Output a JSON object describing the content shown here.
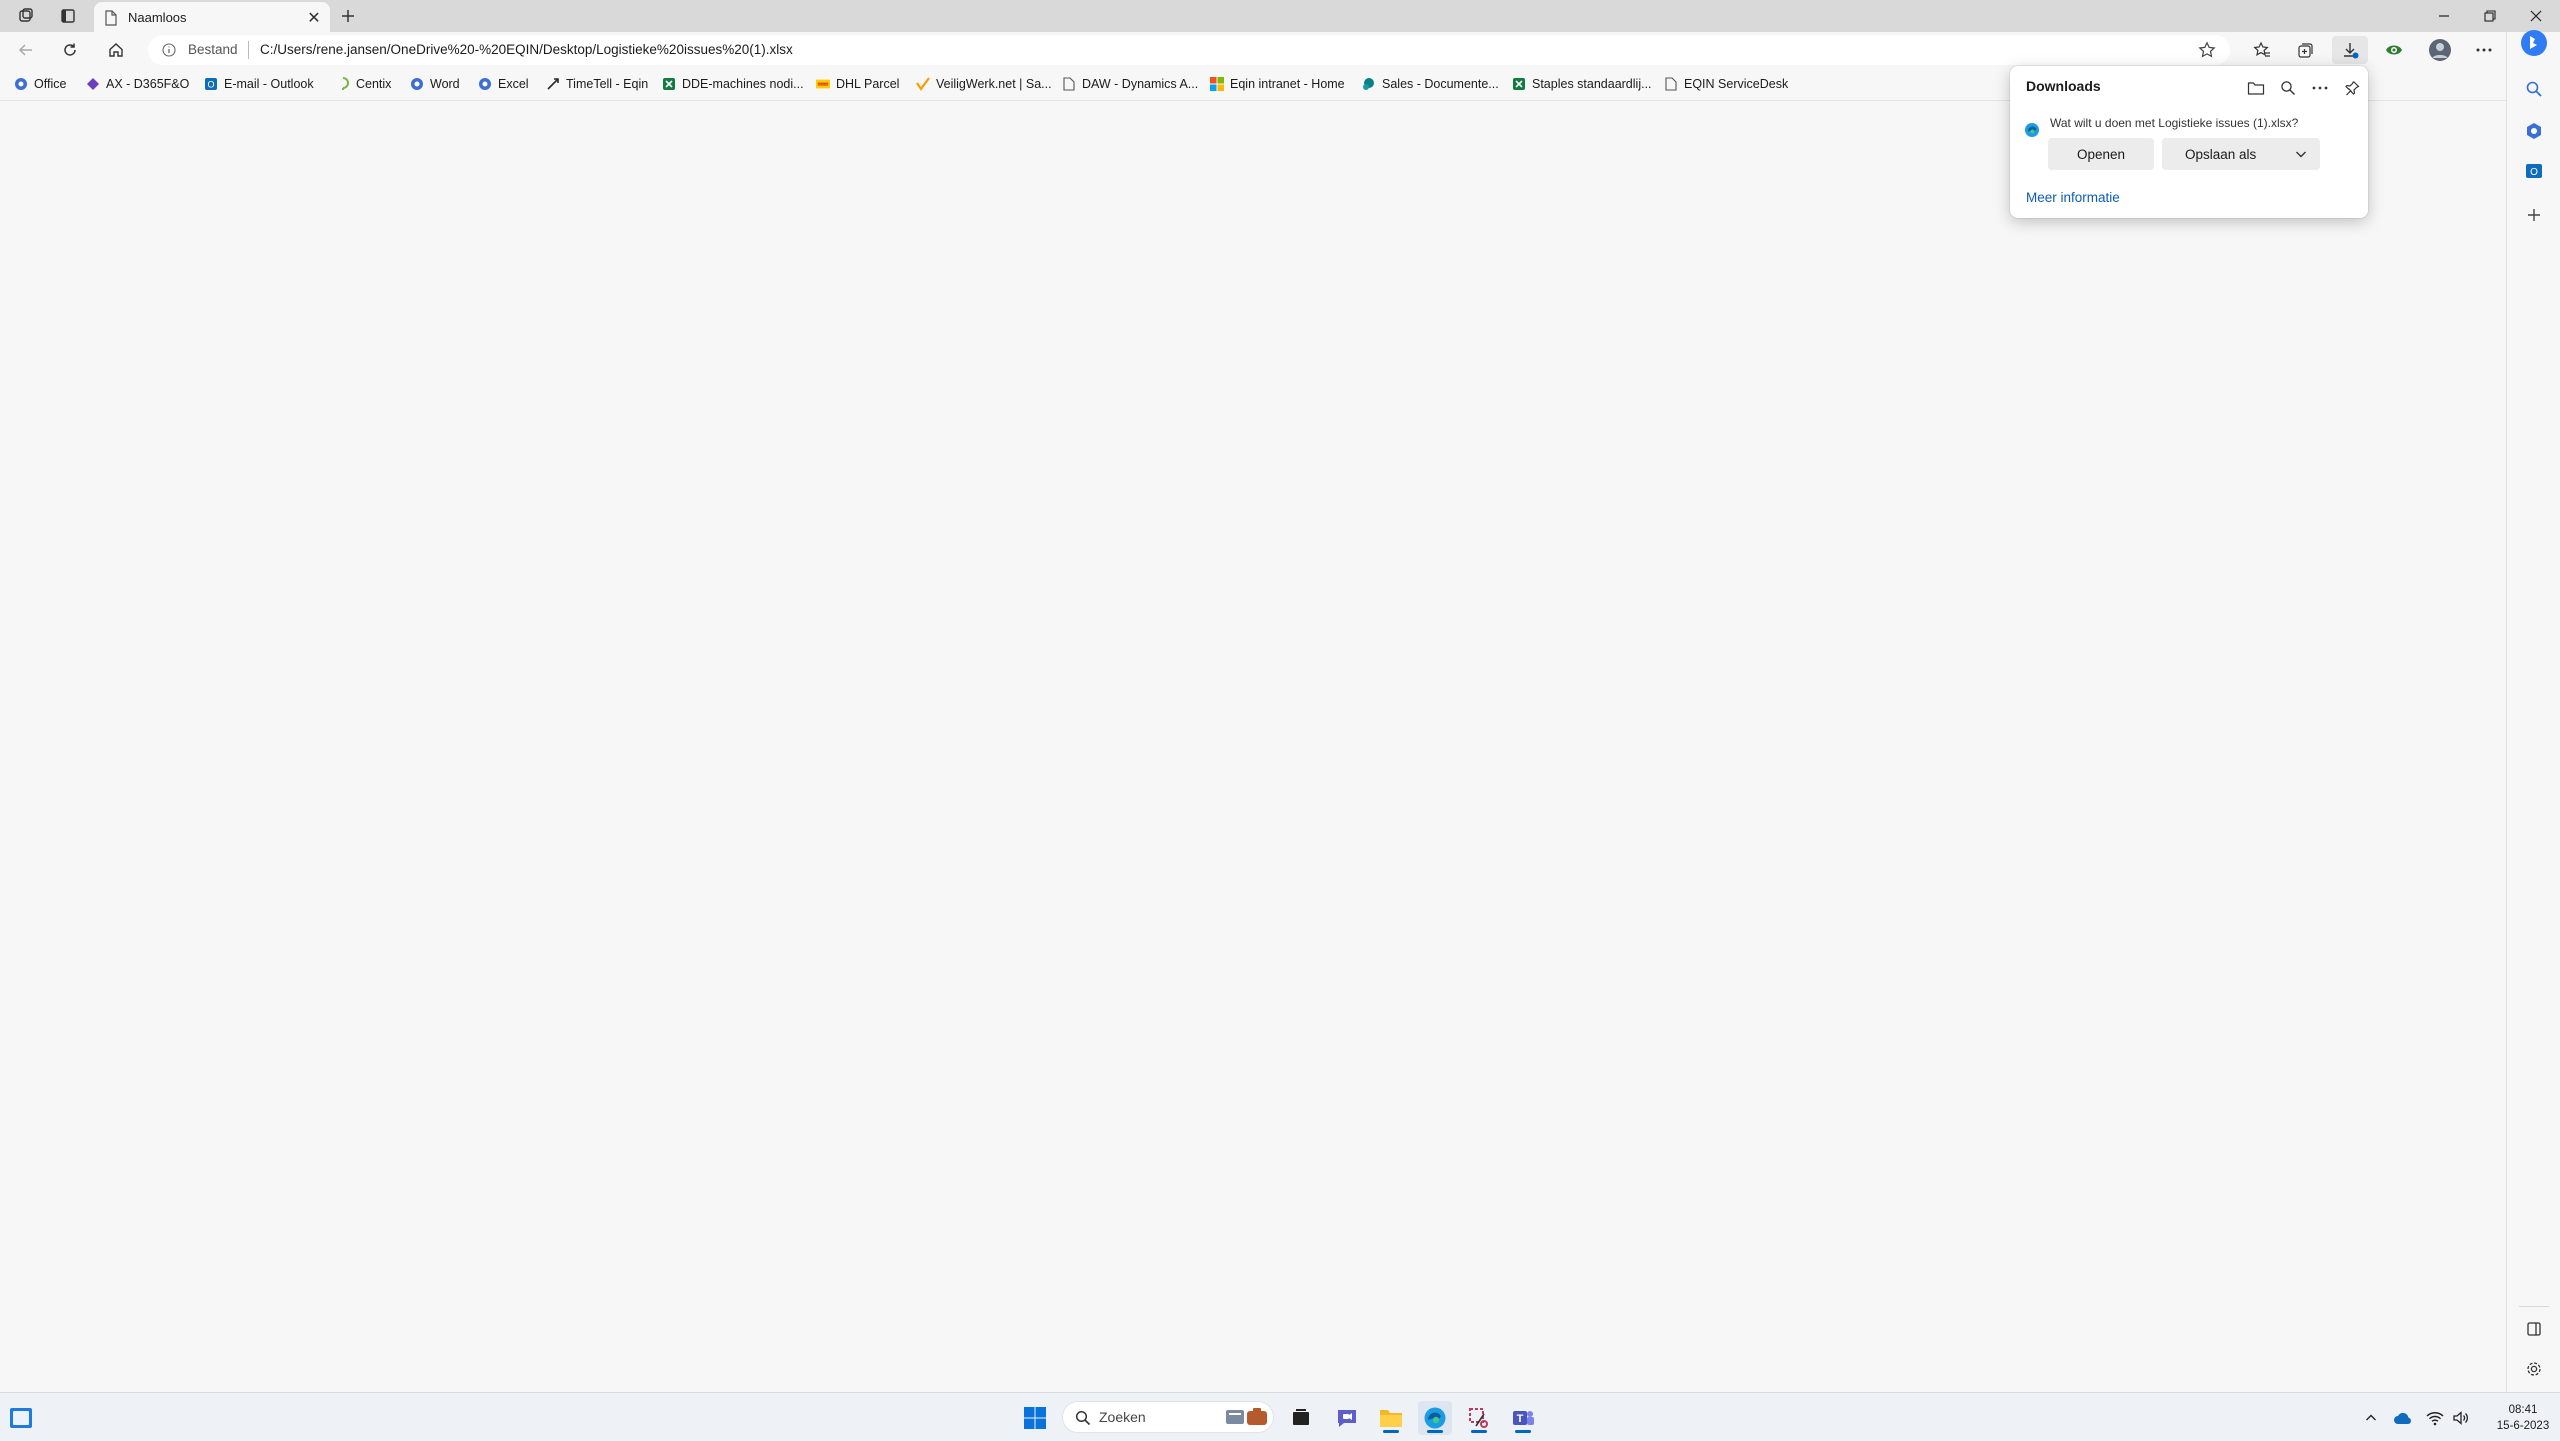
{
  "browser": {
    "tab_title": "Naamloos",
    "address_scheme": "Bestand",
    "address_url": "C:/Users/rene.jansen/OneDrive%20-%20EQIN/Desktop/Logistieke%20issues%20(1).xlsx"
  },
  "bookmarks": [
    {
      "label": "Office",
      "icon": "office-icon",
      "color": "#3b6fd6"
    },
    {
      "label": "AX - D365F&O",
      "icon": "dynamics-icon",
      "color": "#6b3fbf"
    },
    {
      "label": "E-mail - Outlook",
      "icon": "outlook-icon",
      "color": "#0f6cbd"
    },
    {
      "label": "Centix",
      "icon": "centix-icon",
      "color": "#7cb342"
    },
    {
      "label": "Word",
      "icon": "word-icon",
      "color": "#3b6fd6"
    },
    {
      "label": "Excel",
      "icon": "excel-globe-icon",
      "color": "#3b6fd6"
    },
    {
      "label": "TimeTell - Eqin",
      "icon": "timetell-icon",
      "color": "#2b2b2b"
    },
    {
      "label": "DDE-machines nodi...",
      "icon": "excel-icon",
      "color": "#107c41"
    },
    {
      "label": "DHL Parcel",
      "icon": "dhl-icon",
      "color": "#ffcc00"
    },
    {
      "label": "VeiligWerk.net | Sa...",
      "icon": "checkmark-icon",
      "color": "#f5a000"
    },
    {
      "label": "DAW - Dynamics A...",
      "icon": "page-icon",
      "color": "#555555"
    },
    {
      "label": "Eqin intranet - Home",
      "icon": "microsoft-icon",
      "color": "#f25022"
    },
    {
      "label": "Sales - Documente...",
      "icon": "sharepoint-icon",
      "color": "#038387"
    },
    {
      "label": "Staples standaardlij...",
      "icon": "excel-icon",
      "color": "#107c41"
    },
    {
      "label": "EQIN ServiceDesk",
      "icon": "page-icon",
      "color": "#555555"
    }
  ],
  "downloads": {
    "title": "Downloads",
    "prompt": "Wat wilt u doen met Logistieke issues (1).xlsx?",
    "open_label": "Openen",
    "save_as_label": "Opslaan als",
    "more_info": "Meer informatie"
  },
  "taskbar": {
    "search_label": "Zoeken",
    "time": "08:41",
    "date": "15-6-2023"
  },
  "colors": {
    "accent": "#0067c0",
    "link": "#0b5cbd",
    "page_bg": "#f7f7f7",
    "titlebar": "#d9d9d9"
  }
}
